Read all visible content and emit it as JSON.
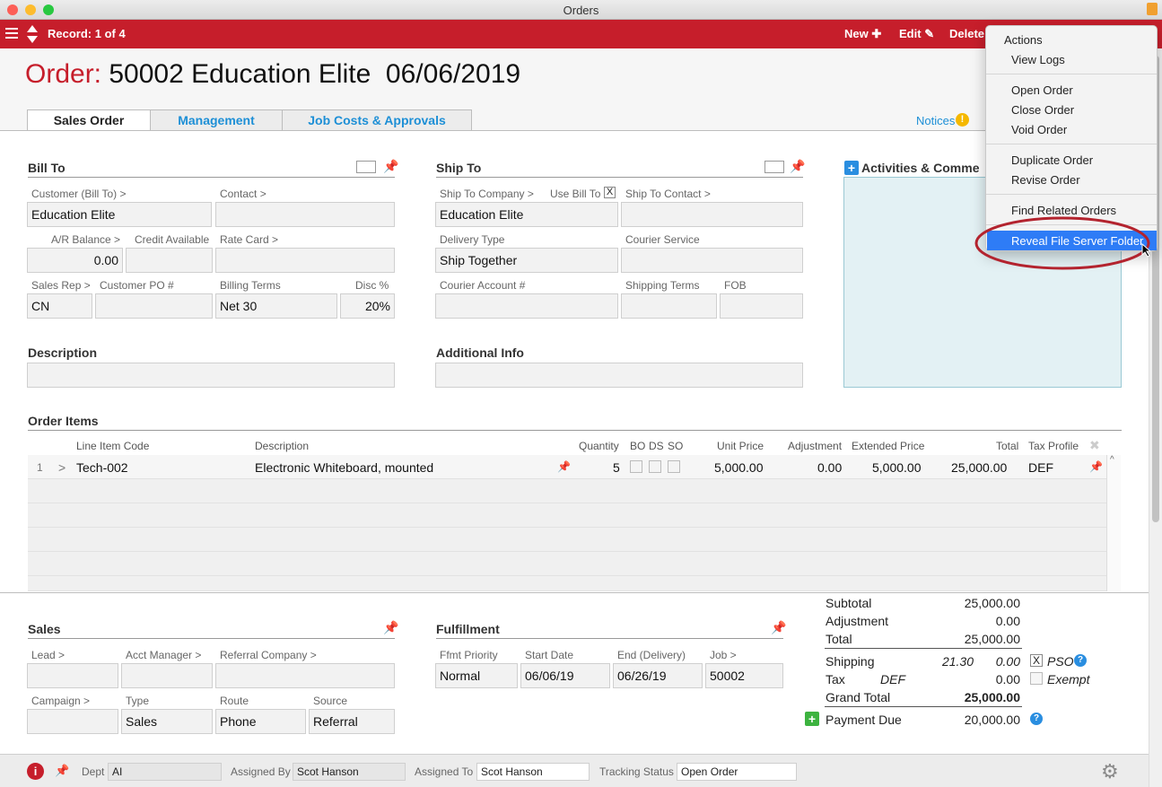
{
  "window": {
    "title": "Orders"
  },
  "toolbar": {
    "record": "Record: 1 of 4",
    "new": "New",
    "edit": "Edit",
    "delete": "Delete"
  },
  "header": {
    "label": "Order:",
    "value": "50002 Education Elite  06/06/2019"
  },
  "tabs": [
    "Sales Order",
    "Management",
    "Job Costs & Approvals"
  ],
  "notices": "Notices",
  "bill_to": {
    "title": "Bill To",
    "customer_label": "Customer (Bill To) >",
    "customer": "Education Elite",
    "contact_label": "Contact >",
    "contact": "",
    "ar_label": "A/R Balance >",
    "ar": "0.00",
    "credit_label": "Credit Available",
    "credit": "",
    "rate_label": "Rate Card >",
    "rate": "",
    "rep_label": "Sales Rep >",
    "rep": "CN",
    "po_label": "Customer PO #",
    "po": "",
    "terms_label": "Billing Terms",
    "terms": "Net 30",
    "disc_label": "Disc %",
    "disc": "20%"
  },
  "ship_to": {
    "title": "Ship To",
    "company_label": "Ship To Company >",
    "company": "Education Elite",
    "use_bill_label": "Use Bill To",
    "use_bill_mark": "X",
    "contact_label": "Ship To Contact >",
    "contact": "",
    "delivery_label": "Delivery Type",
    "delivery": "Ship Together",
    "courier_label": "Courier Service",
    "courier": "",
    "account_label": "Courier Account #",
    "account": "",
    "shipterms_label": "Shipping Terms",
    "shipterms": "",
    "fob_label": "FOB",
    "fob": ""
  },
  "activities": {
    "title": "Activities & Comme"
  },
  "description": {
    "title": "Description",
    "value": ""
  },
  "additional": {
    "title": "Additional Info",
    "value": ""
  },
  "order_items": {
    "title": "Order Items",
    "columns": {
      "code": "Line Item Code",
      "desc": "Description",
      "qty": "Quantity",
      "bo": "BO",
      "ds": "DS",
      "so": "SO",
      "unit": "Unit Price",
      "adj": "Adjustment",
      "ext": "Extended Price",
      "total": "Total",
      "tax": "Tax Profile"
    },
    "rows": [
      {
        "num": "1",
        "code": "Tech-002",
        "desc": "Electronic Whiteboard, mounted",
        "qty": "5",
        "unit": "5,000.00",
        "adj": "0.00",
        "ext": "5,000.00",
        "total": "25,000.00",
        "tax": "DEF"
      }
    ]
  },
  "sales": {
    "title": "Sales",
    "lead_label": "Lead >",
    "lead": "",
    "acct_label": "Acct Manager >",
    "acct": "",
    "referral_label": "Referral Company >",
    "referral": "",
    "campaign_label": "Campaign >",
    "campaign": "",
    "type_label": "Type",
    "type": "Sales",
    "route_label": "Route",
    "route": "Phone",
    "source_label": "Source",
    "source": "Referral"
  },
  "fulfillment": {
    "title": "Fulfillment",
    "priority_label": "Ffmt Priority",
    "priority": "Normal",
    "start_label": "Start Date",
    "start": "06/06/19",
    "end_label": "End (Delivery)",
    "end": "06/26/19",
    "job_label": "Job >",
    "job": "50002"
  },
  "totals": {
    "subtotal_label": "Subtotal",
    "subtotal": "25,000.00",
    "adjustment_label": "Adjustment",
    "adjustment": "0.00",
    "total_label": "Total",
    "total": "25,000.00",
    "shipping_label": "Shipping",
    "shipping_est": "21.30",
    "shipping": "0.00",
    "pso_mark": "X",
    "pso": "PSO",
    "tax_label": "Tax",
    "tax_profile": "DEF",
    "tax": "0.00",
    "exempt": "Exempt",
    "grand_label": "Grand Total",
    "grand": "25,000.00",
    "due_label": "Payment Due",
    "due": "20,000.00"
  },
  "footer": {
    "dept_label": "Dept",
    "dept": "AI",
    "assigned_by_label": "Assigned By",
    "assigned_by": "Scot Hanson",
    "assigned_to_label": "Assigned To",
    "assigned_to": "Scot Hanson",
    "status_label": "Tracking Status",
    "status": "Open Order"
  },
  "menu": {
    "header": "Actions",
    "items": [
      "View Logs",
      "Open Order",
      "Close Order",
      "Void Order",
      "Duplicate Order",
      "Revise Order",
      "Find Related Orders",
      "Reveal File Server Folder"
    ]
  },
  "colors": {
    "brand_red": "#c61e2b",
    "link_blue": "#1d8fd6",
    "highlight": "#2e7cf6",
    "annotation": "#b3232e"
  }
}
